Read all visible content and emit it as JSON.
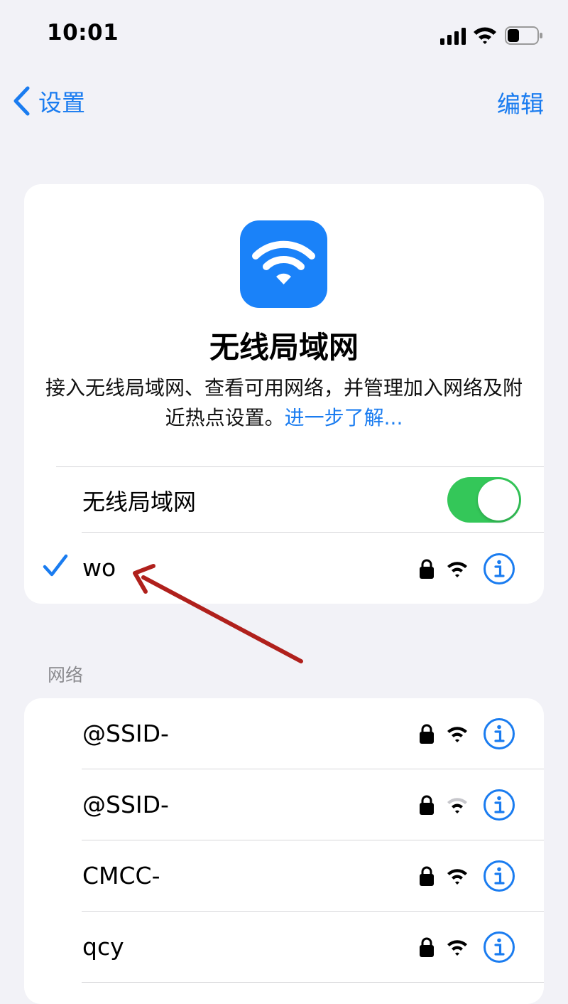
{
  "status_bar": {
    "time": "10:01",
    "icons": [
      "cellular-signal-icon",
      "wifi-icon",
      "battery-icon"
    ]
  },
  "nav": {
    "back_label": "设置",
    "edit_label": "编辑"
  },
  "hero": {
    "icon": "wifi-icon",
    "title": "无线局域网",
    "description": "接入无线局域网、查看可用网络，并管理加入网络及附近热点设置。",
    "learn_more": "进一步了解..."
  },
  "wifi_toggle": {
    "label": "无线局域网",
    "on": true
  },
  "current_network": {
    "name": "wo",
    "connected": true
  },
  "networks_section": {
    "header": "网络",
    "items": [
      {
        "name": "@SSID-",
        "signal": "full"
      },
      {
        "name": "@SSID-",
        "signal": "weak"
      },
      {
        "name": "CMCC-",
        "signal": "full"
      },
      {
        "name": "qcy",
        "signal": "full"
      }
    ]
  },
  "colors": {
    "accent": "#1a7cf0",
    "toggle_on": "#34c759",
    "background": "#f2f2f7",
    "annotation_arrow": "#b0201c"
  }
}
